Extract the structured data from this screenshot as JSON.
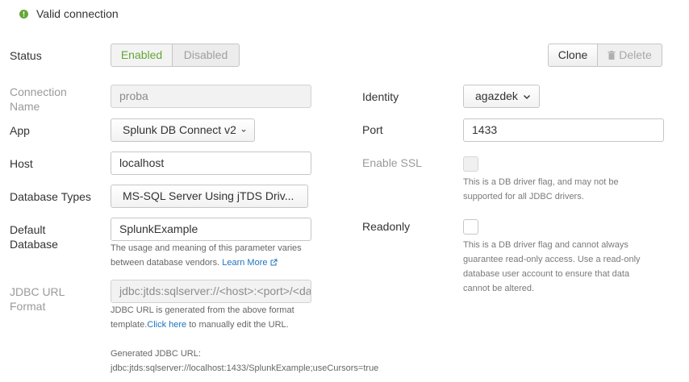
{
  "status_banner": {
    "text": "Valid connection",
    "icon": "info-circle-icon",
    "color": "#65a637"
  },
  "status": {
    "label": "Status",
    "enabled_label": "Enabled",
    "disabled_label": "Disabled",
    "selected": "Enabled"
  },
  "actions": {
    "clone_label": "Clone",
    "delete_label": "Delete",
    "delete_icon": "trash-icon"
  },
  "fields": {
    "connection_name": {
      "label_line1": "Connection",
      "label_line2": "Name",
      "value": "proba"
    },
    "app": {
      "label": "App",
      "value": "Splunk DB Connect v2"
    },
    "host": {
      "label": "Host",
      "value": "localhost"
    },
    "database_types": {
      "label": "Database Types",
      "value": "MS-SQL Server Using jTDS Driv..."
    },
    "default_database": {
      "label_line1": "Default",
      "label_line2": "Database",
      "value": "SplunkExample",
      "help_line1": "The usage and meaning of this parameter varies",
      "help_line2_prefix": "between database vendors.",
      "help_link": "Learn More"
    },
    "jdbc_url_format": {
      "label_line1": "JDBC URL",
      "label_line2": "Format",
      "value": "jdbc:jtds:sqlserver://<host>:<port>/<database>",
      "help_line1": "JDBC URL is generated from the above format",
      "help_line2_prefix": "template.",
      "help_link": "Click here",
      "help_line2_suffix": "to manually edit the URL."
    },
    "generated_url": {
      "label": "Generated JDBC URL:",
      "value": "jdbc:jtds:sqlserver://localhost:1433/SplunkExample;useCursors=true"
    },
    "identity": {
      "label": "Identity",
      "value": "agazdek"
    },
    "port": {
      "label": "Port",
      "value": "1433"
    },
    "enable_ssl": {
      "label": "Enable SSL",
      "help_line1": "This is a DB driver flag, and may not be",
      "help_line2": "supported for all JDBC drivers."
    },
    "readonly": {
      "label": "Readonly",
      "help_line1": "This is a DB driver flag and cannot always",
      "help_line2": "guarantee read-only access. Use a read-only",
      "help_line3": "database user account to ensure that data",
      "help_line4": "cannot be altered."
    }
  }
}
